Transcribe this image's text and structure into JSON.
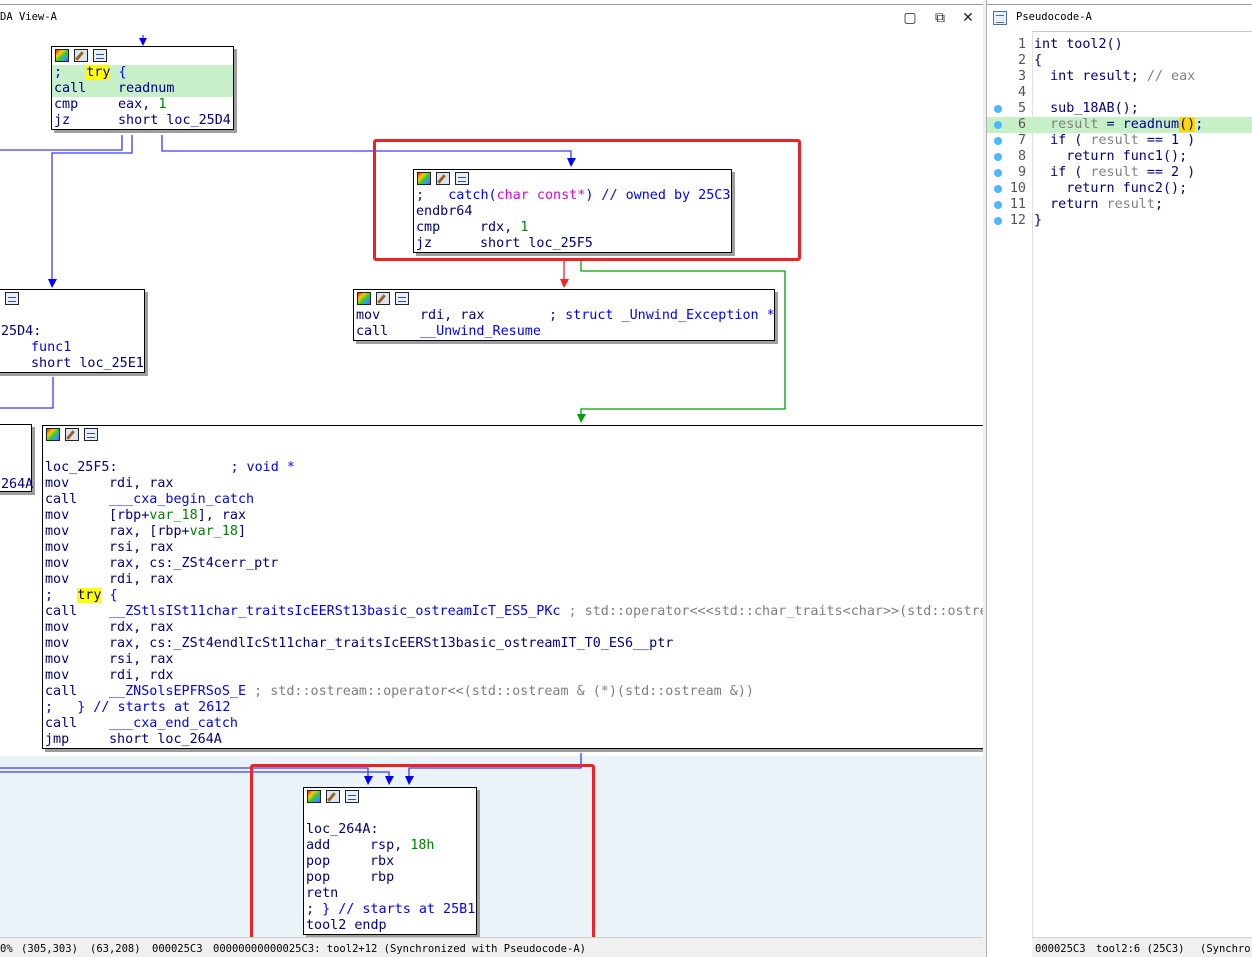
{
  "ida_view": {
    "tab_title": "DA View-A",
    "statusbar": {
      "zoom": "0%",
      "coords1": "(305,303)",
      "coords2": "(63,208)",
      "offset": "000025C3",
      "location": "00000000000025C3: tool2+12 (Synchronized with Pseudocode-A)"
    },
    "nodes": {
      "top": {
        "l1_semi": ";",
        "l1_kw": "try",
        "l1_brace": "{",
        "l2_mn": "call",
        "l2_op": "readnum",
        "l3_mn": "cmp",
        "l3_op": "eax,",
        "l3_num": "1",
        "l4_mn": "jz",
        "l4_op": "short loc_25D4"
      },
      "catch": {
        "l1_semi": ";",
        "l1_text1": "catch(",
        "l1_type": "char const*",
        "l1_text2": ") // owned by 25C3",
        "l2_mn": "endbr64",
        "l3_mn": "cmp",
        "l3_op": "rdx,",
        "l3_num": "1",
        "l4_mn": "jz",
        "l4_op": "short loc_25F5"
      },
      "unwind": {
        "l1_mn": "mov",
        "l1_op": "rdi, rax",
        "l1_comment": "; struct _Unwind_Exception *",
        "l2_mn": "call",
        "l2_op": "__Unwind_Resume"
      },
      "left": {
        "l2_label": "25D4:",
        "l3_op": "func1",
        "l4_op": "short loc_25E1"
      },
      "left_edge": {
        "label": "264A"
      },
      "main": {
        "label": "loc_25F5:",
        "label_comment": "; void *",
        "l1_mn": "mov",
        "l1_op": "rdi, rax",
        "l2_mn": "call",
        "l2_op": "___cxa_begin_catch",
        "l3_mn": "mov",
        "l3_op1": "[rbp+",
        "l3_var": "var_18",
        "l3_op2": "], rax",
        "l4_mn": "mov",
        "l4_op1": "rax, [rbp+",
        "l4_var": "var_18",
        "l4_op2": "]",
        "l5_mn": "mov",
        "l5_op": "rsi, rax",
        "l6_mn": "mov",
        "l6_op": "rax, cs:_ZSt4cerr_ptr",
        "l7_mn": "mov",
        "l7_op": "rdi, rax",
        "l8_semi": ";",
        "l8_kw": "try",
        "l8_brace": "{",
        "l9_mn": "call",
        "l9_op": "__ZStlsISt11char_traitsIcEERSt13basic_ostreamIcT_ES5_PKc",
        "l9_comment": "; std::operator<<<std::char_traits<char>>(std::ostre",
        "l10_mn": "mov",
        "l10_op": "rdx, rax",
        "l11_mn": "mov",
        "l11_op": "rax, cs:_ZSt4endlIcSt11char_traitsIcEERSt13basic_ostreamIT_T0_ES6__ptr",
        "l12_mn": "mov",
        "l12_op": "rsi, rax",
        "l13_mn": "mov",
        "l13_op": "rdi, rdx",
        "l14_mn": "call",
        "l14_op": "__ZNSolsEPFRSoS_E",
        "l14_comment": "; std::ostream::operator<<(std::ostream & (*)(std::ostream &))",
        "l15": ";   } // starts at 2612",
        "l16_mn": "call",
        "l16_op": "___cxa_end_catch",
        "l17_mn": "jmp",
        "l17_op": "short loc_264A"
      },
      "bottom": {
        "label": "loc_264A:",
        "l1_mn": "add",
        "l1_op": "rsp,",
        "l1_num": "18h",
        "l2_mn": "pop",
        "l2_op": "rbx",
        "l3_mn": "pop",
        "l3_op": "rbp",
        "l4_mn": "retn",
        "l5": "; } // starts at 25B1",
        "l6": "tool2 endp"
      }
    }
  },
  "pseudocode": {
    "tab_title": "Pseudocode-A",
    "lines": [
      {
        "num": "1",
        "text": "int tool2()"
      },
      {
        "num": "2",
        "text": "{"
      },
      {
        "num": "3",
        "decl": "  int result;",
        "comment": " // eax"
      },
      {
        "num": "4",
        "text": ""
      },
      {
        "num": "5",
        "text": "  sub_18AB();"
      },
      {
        "num": "6",
        "var": "  result",
        "mid": " = ",
        "fn": "readnum",
        "paren": "()",
        "tail": ";"
      },
      {
        "num": "7",
        "pre": "  if ( ",
        "var": "result",
        "post": " == 1 )"
      },
      {
        "num": "8",
        "text": "    return func1();"
      },
      {
        "num": "9",
        "pre": "  if ( ",
        "var": "result",
        "post": " == 2 )"
      },
      {
        "num": "10",
        "text": "    return func2();"
      },
      {
        "num": "11",
        "pre": "  return ",
        "var": "result",
        "post": ";"
      },
      {
        "num": "12",
        "text": "}"
      }
    ],
    "statusbar": {
      "offset": "000025C3",
      "location": "tool2:6 (25C3)",
      "sync": "(Synchro"
    }
  }
}
